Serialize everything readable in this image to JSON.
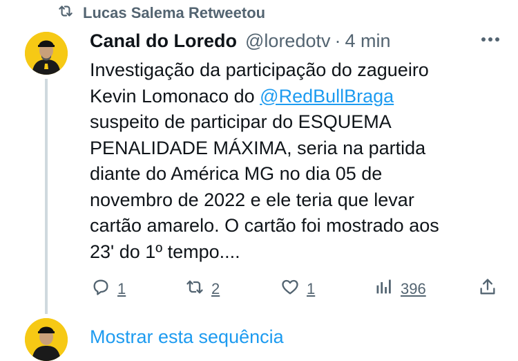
{
  "retweet_banner": {
    "text": "Lucas Salema Retweetou"
  },
  "tweet": {
    "display_name": "Canal do Loredo",
    "handle": "@loredotv",
    "separator": "·",
    "time": "4 min",
    "text_lines": [
      "Investigação da participação do zagueiro",
      "Kevin Lomonaco do ",
      "@RedBullBraga",
      "suspeito de participar do ESQUEMA",
      "PENALIDADE MÁXIMA, seria na partida",
      "diante do América MG no dia 05 de",
      "novembro de 2022 e ele teria que levar",
      "cartão amarelo. O cartão foi mostrado aos",
      "23' do 1º tempo...."
    ],
    "actions": {
      "reply_count": "1",
      "retweet_count": "2",
      "like_count": "1",
      "views_count": "396"
    }
  },
  "show_thread": {
    "label": "Mostrar esta sequência"
  },
  "icons": {
    "retweet": "retweet-icon",
    "reply": "reply-icon",
    "like": "heart-icon",
    "views": "views-icon",
    "share": "share-icon",
    "more": "more-icon"
  },
  "colors": {
    "link": "#1d9bf0",
    "secondary_text": "#536471",
    "avatar_bg": "#f6c915",
    "thread_line": "#cfd9de"
  }
}
